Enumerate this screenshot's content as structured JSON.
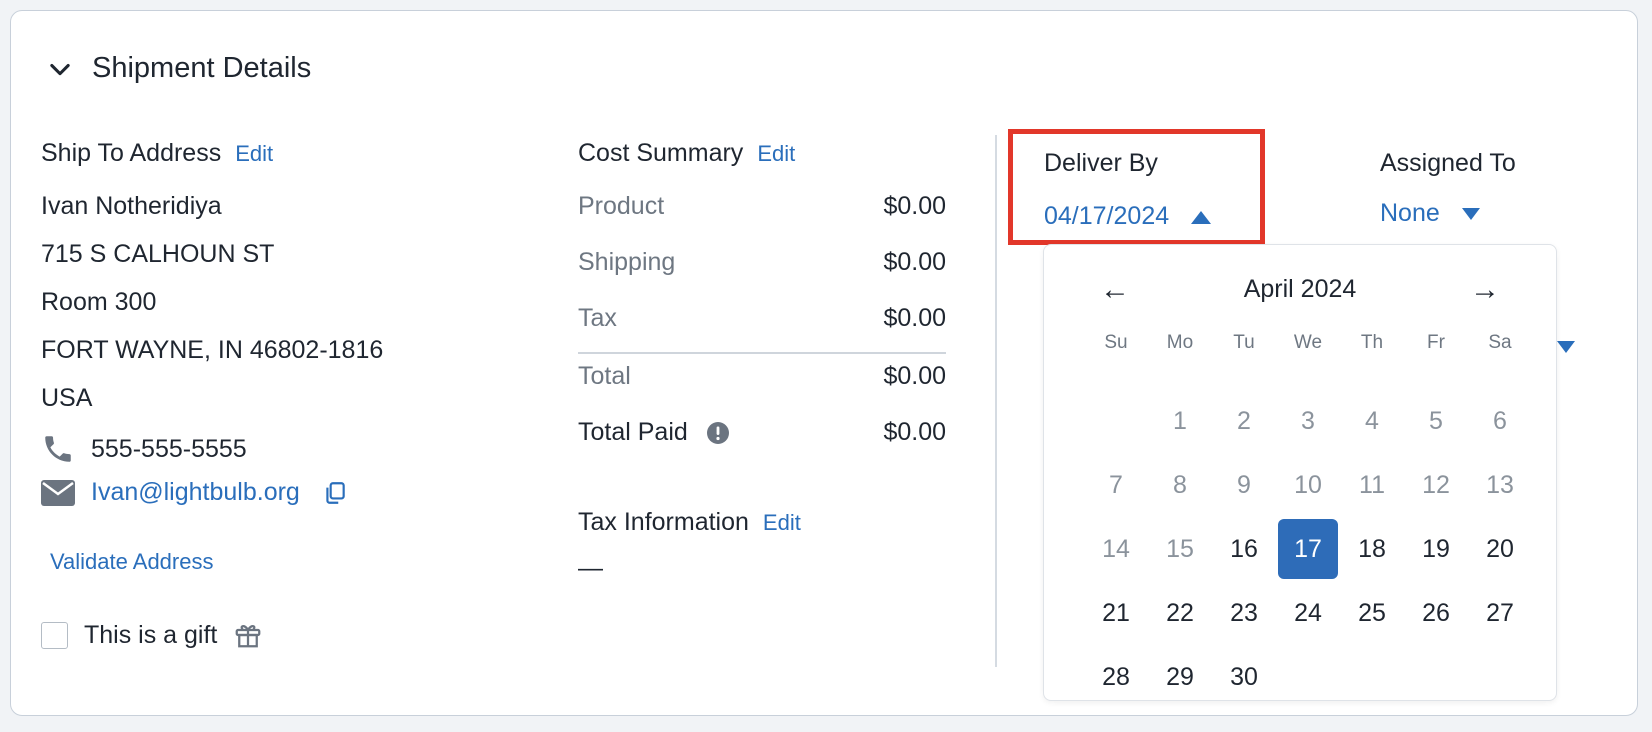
{
  "section": {
    "title": "Shipment Details"
  },
  "ship_to": {
    "title": "Ship To Address",
    "edit_label": "Edit",
    "name": "Ivan Notheridiya",
    "street": "715 S CALHOUN ST",
    "room": "Room 300",
    "city_line": "FORT WAYNE, IN 46802-1816",
    "country": "USA",
    "phone": "555-555-5555",
    "email": "Ivan@lightbulb.org",
    "validate_label": "Validate Address",
    "gift_label": "This is a gift"
  },
  "cost_summary": {
    "title": "Cost Summary",
    "edit_label": "Edit",
    "rows": [
      {
        "label": "Product",
        "value": "$0.00"
      },
      {
        "label": "Shipping",
        "value": "$0.00"
      },
      {
        "label": "Tax",
        "value": "$0.00"
      },
      {
        "label": "Total",
        "value": "$0.00"
      },
      {
        "label": "Total Paid",
        "value": "$0.00"
      }
    ]
  },
  "tax_info": {
    "title": "Tax Information",
    "edit_label": "Edit",
    "value": "—"
  },
  "deliver_by": {
    "title": "Deliver By",
    "value": "04/17/2024"
  },
  "assigned_to": {
    "title": "Assigned To",
    "value": "None"
  },
  "calendar": {
    "month_label": "April 2024",
    "prev": "←",
    "next": "→",
    "weekdays": [
      "Su",
      "Mo",
      "Tu",
      "We",
      "Th",
      "Fr",
      "Sa"
    ],
    "leading_blanks": 1,
    "days_in_month": 30,
    "selected_day": 17,
    "min_enabled_day": 16
  },
  "colors": {
    "accent": "#2a6ebb",
    "selected": "#2e6cb8",
    "highlight": "#e2372a"
  }
}
